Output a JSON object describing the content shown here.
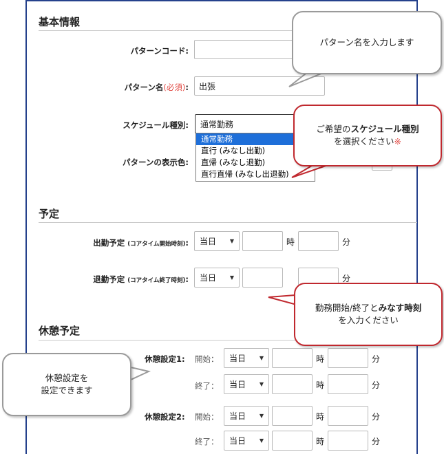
{
  "sections": {
    "basic": "基本情報",
    "schedule": "予定",
    "break": "休憩予定"
  },
  "basic": {
    "pattern_code_label": "パターンコード:",
    "pattern_code_value": "",
    "pattern_name_label": "パターン名",
    "required": "(必須)",
    "colon": ":",
    "pattern_name_value": "出張",
    "schedule_type_label": "スケジュール種別:",
    "schedule_type_value": "通常勤務",
    "schedule_type_options": [
      "通常勤務",
      "直行 (みなし出勤)",
      "直帰 (みなし退勤)",
      "直行直帰 (みなし出退勤)"
    ],
    "display_color_label": "パターンの表示色:"
  },
  "schedule": {
    "start_label": "出勤予定",
    "start_sub": "(コアタイム開始時刻)",
    "end_label": "退勤予定",
    "end_sub": "(コアタイム終了時刻)",
    "colon": ":",
    "day_value": "当日",
    "hour_unit": "時",
    "minute_unit": "分"
  },
  "break": {
    "setting1_label": "休憩設定1:",
    "setting2_label": "休憩設定2:",
    "start": "開始：",
    "end": "終了：",
    "day_value": "当日",
    "hour_unit": "時",
    "minute_unit": "分"
  },
  "callouts": {
    "pattern_name": "パターン名を入力します",
    "schedule_type_pre": "ご希望の",
    "schedule_type_bold": "スケジュール種別",
    "schedule_type_post": "を選択ください",
    "schedule_type_mark": "※",
    "time_pre": "勤務開始/終了と",
    "time_bold": "みなす時刻",
    "time_post": "を入力ください",
    "break_line1": "休憩設定を",
    "break_line2": "設定できます"
  },
  "colors": {
    "frame": "#25418c",
    "required": "#e0453f",
    "callout_red": "#c0282e",
    "callout_gray": "#9a9a9a",
    "selected": "#1e6fd9"
  }
}
